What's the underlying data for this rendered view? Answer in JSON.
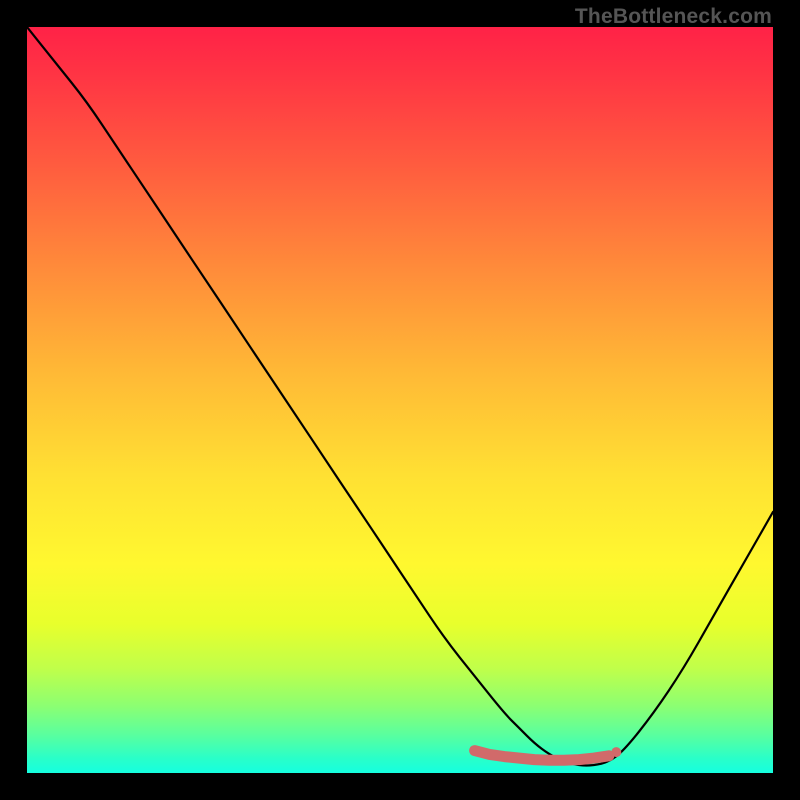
{
  "watermark": "TheBottleneck.com",
  "colors": {
    "background": "#000000",
    "curve_stroke": "#000000",
    "marker_stroke": "#d16a6a",
    "marker_fill": "#d16a6a"
  },
  "chart_data": {
    "type": "line",
    "title": "",
    "xlabel": "",
    "ylabel": "",
    "xlim": [
      0,
      100
    ],
    "ylim": [
      0,
      100
    ],
    "grid": false,
    "legend": false,
    "series": [
      {
        "name": "bottleneck-curve",
        "x": [
          0,
          4,
          8,
          12,
          16,
          20,
          24,
          28,
          32,
          36,
          40,
          44,
          48,
          52,
          56,
          60,
          64,
          66,
          68,
          70,
          72,
          74,
          76,
          78,
          80,
          84,
          88,
          92,
          96,
          100
        ],
        "y": [
          100,
          95,
          90,
          84,
          78,
          72,
          66,
          60,
          54,
          48,
          42,
          36,
          30,
          24,
          18,
          13,
          8,
          6,
          4,
          2.5,
          1.5,
          1,
          1,
          1.5,
          3,
          8,
          14,
          21,
          28,
          35
        ]
      }
    ],
    "markers": {
      "name": "highlight-segment",
      "x": [
        60,
        62,
        64,
        66,
        68,
        70,
        72,
        74,
        76,
        78
      ],
      "y": [
        3,
        2.5,
        2.2,
        2,
        1.8,
        1.7,
        1.7,
        1.8,
        2,
        2.3
      ]
    },
    "gradient_stops": [
      {
        "pos": 0,
        "color": "#ff2247"
      },
      {
        "pos": 18,
        "color": "#ff5a3f"
      },
      {
        "pos": 46,
        "color": "#ffb836"
      },
      {
        "pos": 72,
        "color": "#fff82f"
      },
      {
        "pos": 91,
        "color": "#8cff72"
      },
      {
        "pos": 100,
        "color": "#15ffe0"
      }
    ]
  }
}
